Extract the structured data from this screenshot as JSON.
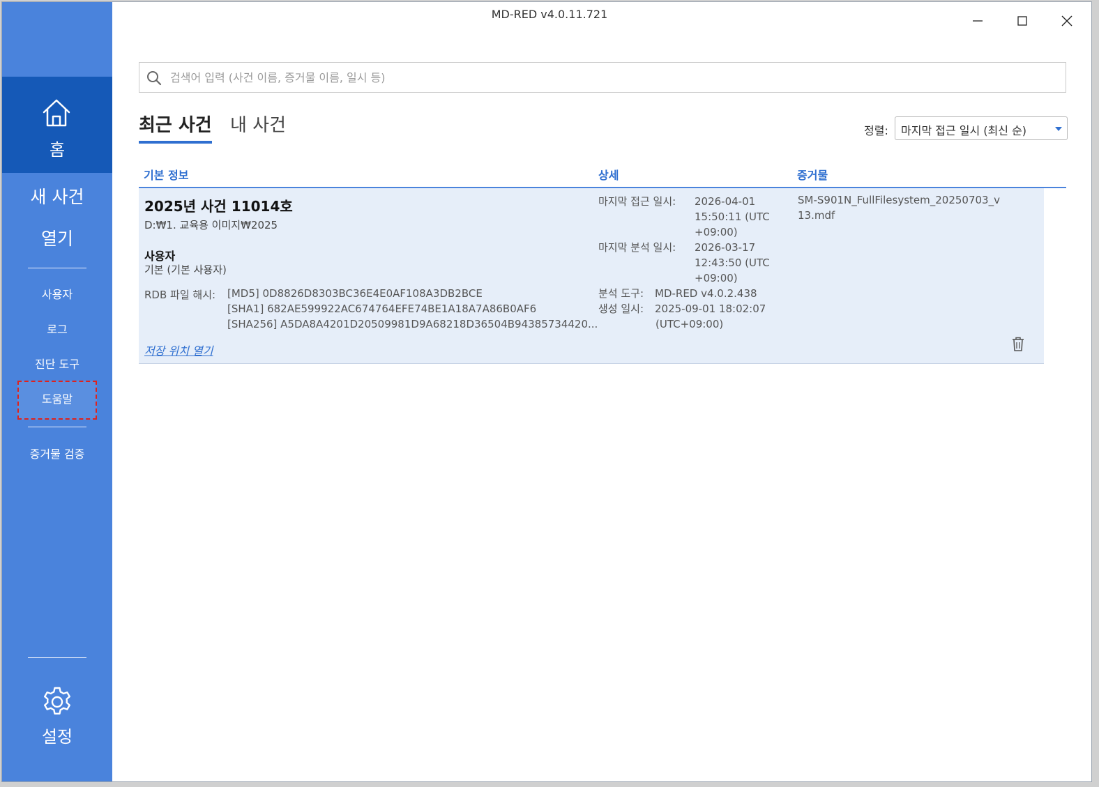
{
  "window": {
    "title": "MD-RED v4.0.11.721",
    "controls": {
      "minimize": "minimize-icon",
      "maximize": "maximize-icon",
      "close": "close-icon"
    }
  },
  "sidebar": {
    "home_label": "홈",
    "new_case_line1": "새 사건",
    "new_case_line2": "열기",
    "items": [
      {
        "label": "사용자"
      },
      {
        "label": "로그"
      },
      {
        "label": "진단 도구"
      },
      {
        "label": "도움말"
      },
      {
        "label": "증거물 검증"
      }
    ],
    "settings_label": "설정"
  },
  "search": {
    "placeholder": "검색어 입력 (사건 이름, 증거물 이름, 일시 등)",
    "value": ""
  },
  "tabs": [
    {
      "label": "최근 사건",
      "active": true
    },
    {
      "label": "내 사건",
      "active": false
    }
  ],
  "sort": {
    "label": "정렬:",
    "selected": "마지막 접근 일시 (최신 순)"
  },
  "table": {
    "headers": [
      "기본 정보",
      "상세",
      "증거물"
    ],
    "rows": [
      {
        "title": "2025년 사건 11014호",
        "path": "D:₩1. 교육용 이미지₩2025",
        "user_label": "사용자",
        "user_value": "기본 (기본 사용자)",
        "hash_label": "RDB 파일 해시:",
        "hashes": [
          "[MD5] 0D8826D8303BC36E4E0AF108A3DB2BCE",
          "[SHA1] 682AE599922AC674764EFE74BE1A18A7A86B0AF6",
          "[SHA256] A5DA8A4201D20509981D9A68218D36504B94385734420..."
        ],
        "open_location": "저장 위치 열기",
        "last_access_label": "마지막 접근 일시:",
        "last_access_lines": [
          "2026-04-01",
          "15:50:11 (UTC",
          "+09:00)"
        ],
        "last_analysis_label": "마지막 분석 일시:",
        "last_analysis_lines": [
          "2026-03-17",
          "12:43:50 (UTC",
          "+09:00)"
        ],
        "tool_label": "분석 도구:",
        "tool_value": "MD-RED v4.0.2.438",
        "created_label": "생성 일시:",
        "created_lines": [
          "2025-09-01 18:02:07",
          "(UTC+09:00)"
        ],
        "evidence": "SM-S901N_FullFilesystem_20250703_v13.mdf"
      }
    ]
  },
  "colors": {
    "sidebar": "#4a83dc",
    "sidebar_active": "#1559b7",
    "accent": "#2f6fd0",
    "row_bg": "#e6eef9",
    "highlight_dashed": "#e0221c"
  }
}
